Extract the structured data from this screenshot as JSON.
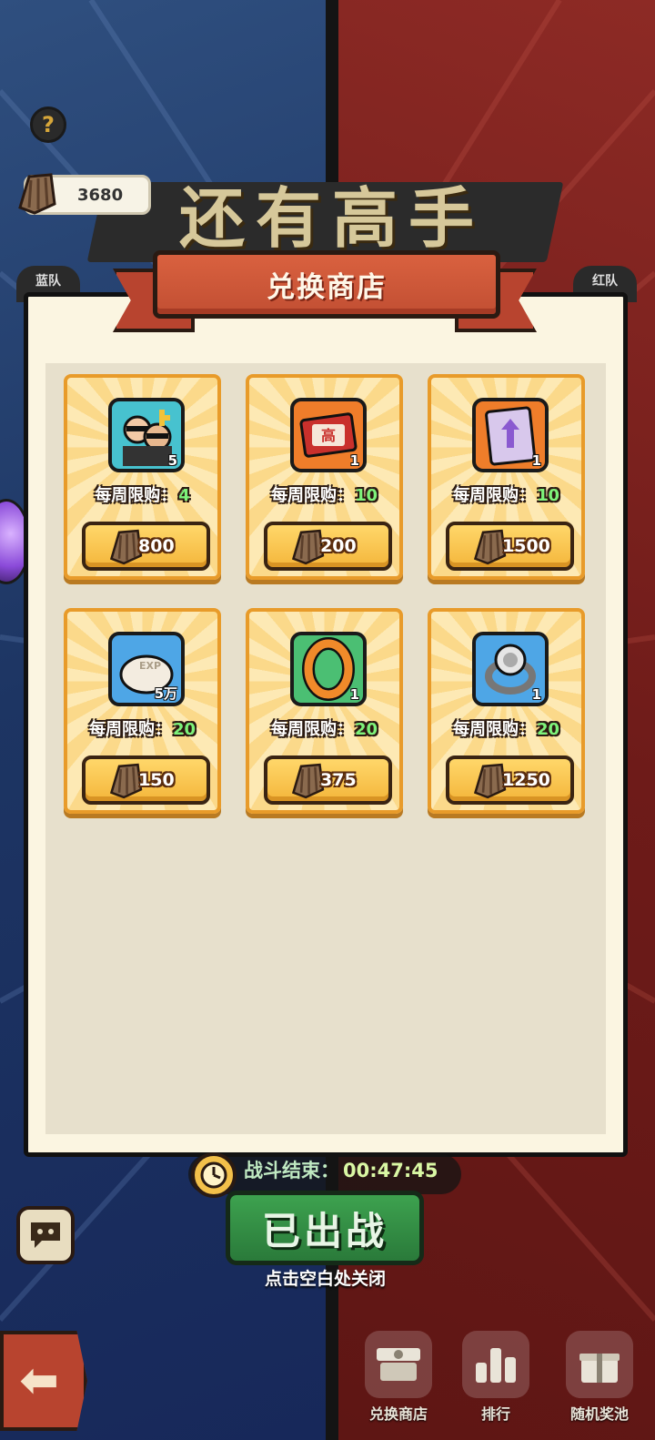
{
  "currency": {
    "amount": "3680"
  },
  "background": {
    "banner_text": "还有高手",
    "left_tag": "蓝队",
    "right_tag": "红队"
  },
  "modal": {
    "title": "兑换商店",
    "limit_label": "每周限购：",
    "items": [
      {
        "icon": "character-duo-icon",
        "quantity": "5",
        "limit": "4",
        "price": "800",
        "color": "#47c2cf"
      },
      {
        "icon": "red-ticket-icon",
        "quantity": "1",
        "limit": "10",
        "price": "200",
        "color": "#ef7d2a"
      },
      {
        "icon": "purple-card-icon",
        "quantity": "1",
        "limit": "10",
        "price": "1500",
        "color": "#ef7d2a"
      },
      {
        "icon": "exp-bun-icon",
        "quantity": "5万",
        "limit": "20",
        "price": "150",
        "color": "#4ea6e6"
      },
      {
        "icon": "orange-ring-icon",
        "quantity": "1",
        "limit": "20",
        "price": "375",
        "color": "#4bbf73"
      },
      {
        "icon": "silver-ring-icon",
        "quantity": "1",
        "limit": "20",
        "price": "1250",
        "color": "#4ea6e6"
      }
    ]
  },
  "battle": {
    "timer_label": "战斗结束：",
    "timer_value": "00:47:45",
    "sortie_label": "已出战"
  },
  "close_hint": "点击空白处关闭",
  "bottom_nav": {
    "shop": "兑换商店",
    "rank": "排行",
    "pool": "随机奖池"
  }
}
